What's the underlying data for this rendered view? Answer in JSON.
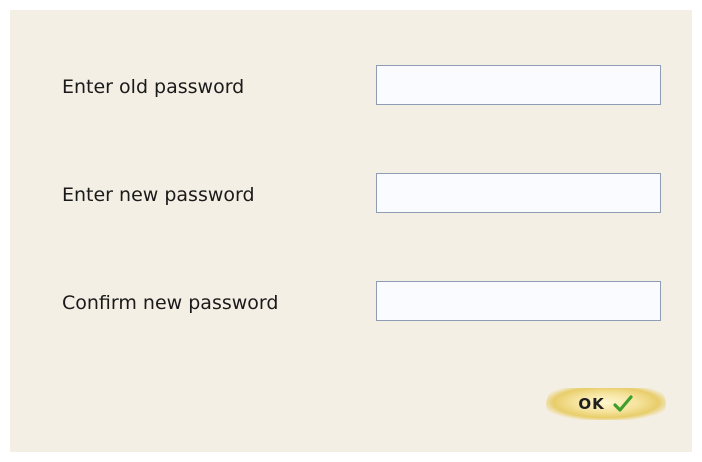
{
  "form": {
    "fields": [
      {
        "label": "Enter old password",
        "value": ""
      },
      {
        "label": "Enter new password",
        "value": ""
      },
      {
        "label": "Confirm new password",
        "value": ""
      }
    ],
    "ok_label": "OK",
    "ok_icon": "check-icon"
  },
  "colors": {
    "panel_background": "#f4efe4",
    "input_border": "#8e9cb4",
    "button_gold": "#f5e39c",
    "check_green": "#3f9f2a"
  }
}
